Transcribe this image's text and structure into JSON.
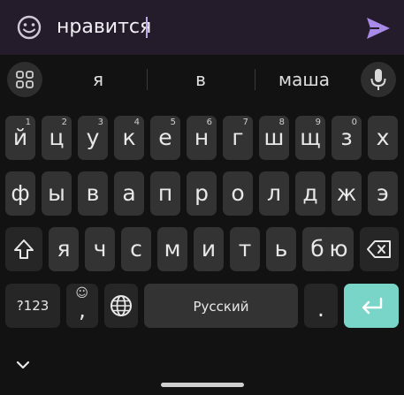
{
  "compose": {
    "text": "нравится",
    "emoji_icon": "smiley-icon",
    "send_icon": "send-icon"
  },
  "suggestions": {
    "words": [
      "я",
      "в",
      "маша"
    ],
    "apps_icon": "grid-icon",
    "mic_icon": "microphone-icon"
  },
  "rows": {
    "row1": [
      {
        "k": "й",
        "h": "1"
      },
      {
        "k": "ц",
        "h": "2"
      },
      {
        "k": "у",
        "h": "3"
      },
      {
        "k": "к",
        "h": "4"
      },
      {
        "k": "е",
        "h": "5"
      },
      {
        "k": "н",
        "h": "6"
      },
      {
        "k": "г",
        "h": "7"
      },
      {
        "k": "ш",
        "h": "8"
      },
      {
        "k": "щ",
        "h": "9"
      },
      {
        "k": "з",
        "h": "0"
      },
      {
        "k": "х",
        "h": ""
      }
    ],
    "row2": [
      "ф",
      "ы",
      "в",
      "а",
      "п",
      "р",
      "о",
      "л",
      "д",
      "ж",
      "э"
    ],
    "row3": [
      "я",
      "ч",
      "с",
      "м",
      "и",
      "т",
      "ь",
      "б",
      "ю"
    ]
  },
  "bottom_row": {
    "symbols_label": "?123",
    "comma_label": ",",
    "comma_hint": "☺",
    "space_label": "Русский",
    "period_label": "."
  },
  "colors": {
    "enter_key": "#79d5c8",
    "send_icon": "#a88be8",
    "compose_bg": "#241c2b"
  }
}
